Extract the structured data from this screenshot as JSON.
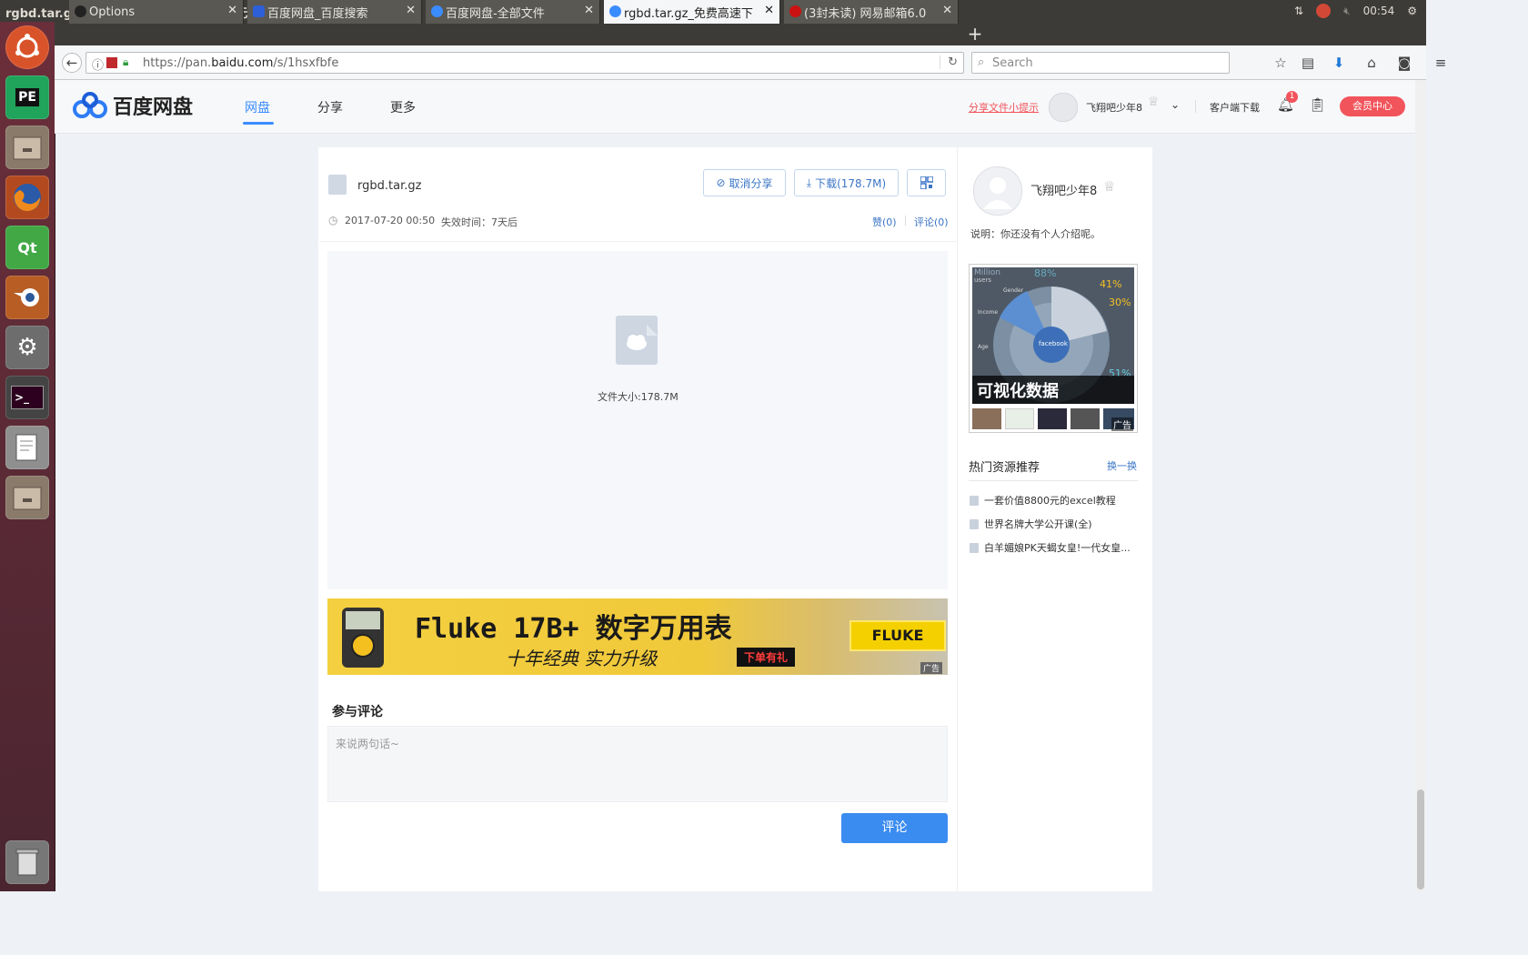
{
  "window": {
    "title": "rgbd.tar.gz_免费高速下载|百度网盘-分享无限制 - Mozilla Firefox",
    "clock": "00:54"
  },
  "tabs": [
    {
      "label": "Options"
    },
    {
      "label": "百度网盘_百度搜索"
    },
    {
      "label": "百度网盘-全部文件"
    },
    {
      "label": "rgbd.tar.gz_免费高速下"
    },
    {
      "label": "(3封未读) 网易邮箱6.0"
    }
  ],
  "nav": {
    "url_prefix": "https://pan.",
    "url_domain": "baidu.com",
    "url_path": "/s/1hsxfbfe",
    "search_placeholder": "Search"
  },
  "launcher": {
    "pycharm": "PE",
    "qt": "Qt"
  },
  "site": {
    "brand": "百度网盘",
    "menu": [
      "网盘",
      "分享",
      "更多"
    ],
    "share_tip": "分享文件小提示",
    "username": "飞翔吧少年8",
    "client_download": "客户端下载",
    "notify_count": "1",
    "vip": "会员中心"
  },
  "file": {
    "name": "rgbd.tar.gz",
    "cancel_share": "取消分享",
    "download": "下载(178.7M)",
    "date": "2017-07-20 00:50",
    "expire": "失效时间：7天后",
    "like": "赞(0)",
    "comments_link": "评论(0)",
    "size_label": "文件大小:178.7M"
  },
  "ad_banner": {
    "brand": "Fluke 17B+ 数字万用表",
    "slogan": "十年经典 实力升级",
    "promo": "下单有礼",
    "logo": "FLUKE",
    "ad_tag": "广告"
  },
  "comment": {
    "heading": "参与评论",
    "placeholder": "来说两句话~",
    "submit": "评论"
  },
  "sidebar": {
    "username": "飞翔吧少年8",
    "intro": "说明：你还没有个人介绍呢。",
    "ad_caption": "可视化数据",
    "ad_tag": "广告",
    "ad_chart_texts": [
      "Million",
      "users",
      "88%",
      "41%",
      "30%",
      "51%",
      "facebook",
      "Gender",
      "Income",
      "Age"
    ],
    "hot_title": "热门资源推荐",
    "refresh": "换一换",
    "hot_items": [
      "一套价值8800元的excel教程",
      "世界名牌大学公开课(全)",
      "白羊媚娘PK天蝎女皇!一代女皇..."
    ]
  },
  "colors": {
    "accent": "#3b8cff",
    "vip_red": "#f2545b",
    "submit_blue": "#3b8cf0"
  }
}
